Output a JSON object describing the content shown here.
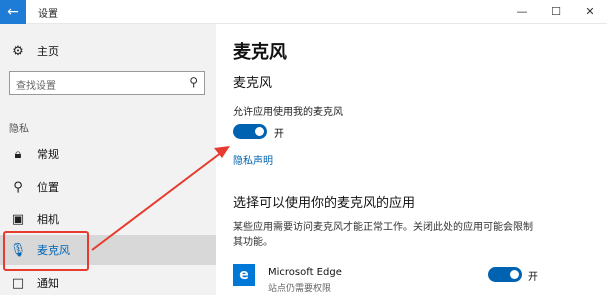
{
  "window": {
    "title": "设置",
    "back_icon": "back-arrow-icon",
    "controls": [
      "—",
      "☐",
      "✕"
    ]
  },
  "sidebar": {
    "home_label": "主页",
    "search_placeholder": "查找设置",
    "section_label": "隐私",
    "items": [
      {
        "label": "常规",
        "icon": "lock-icon"
      },
      {
        "label": "位置",
        "icon": "location-icon"
      },
      {
        "label": "相机",
        "icon": "camera-icon"
      },
      {
        "label": "麦克风",
        "icon": "microphone-icon",
        "active": true
      },
      {
        "label": "通知",
        "icon": "notification-icon"
      }
    ]
  },
  "main": {
    "page_title": "麦克风",
    "sub_title": "麦克风",
    "allow_label": "允许应用使用我的麦克风",
    "toggle_state": "开",
    "privacy_link": "隐私声明",
    "section_title": "选择可以使用你的麦克风的应用",
    "description": "某些应用需要访问麦克风才能正常工作。关闭此处的应用可能会限制其功能。",
    "apps": [
      {
        "name": "Microsoft Edge",
        "subtitle": "站点仍需要权限",
        "state": "开"
      }
    ]
  },
  "colors": {
    "accent": "#0063b1",
    "annotation": "#e63b2e",
    "sidebar_bg": "#f2f2f2"
  }
}
